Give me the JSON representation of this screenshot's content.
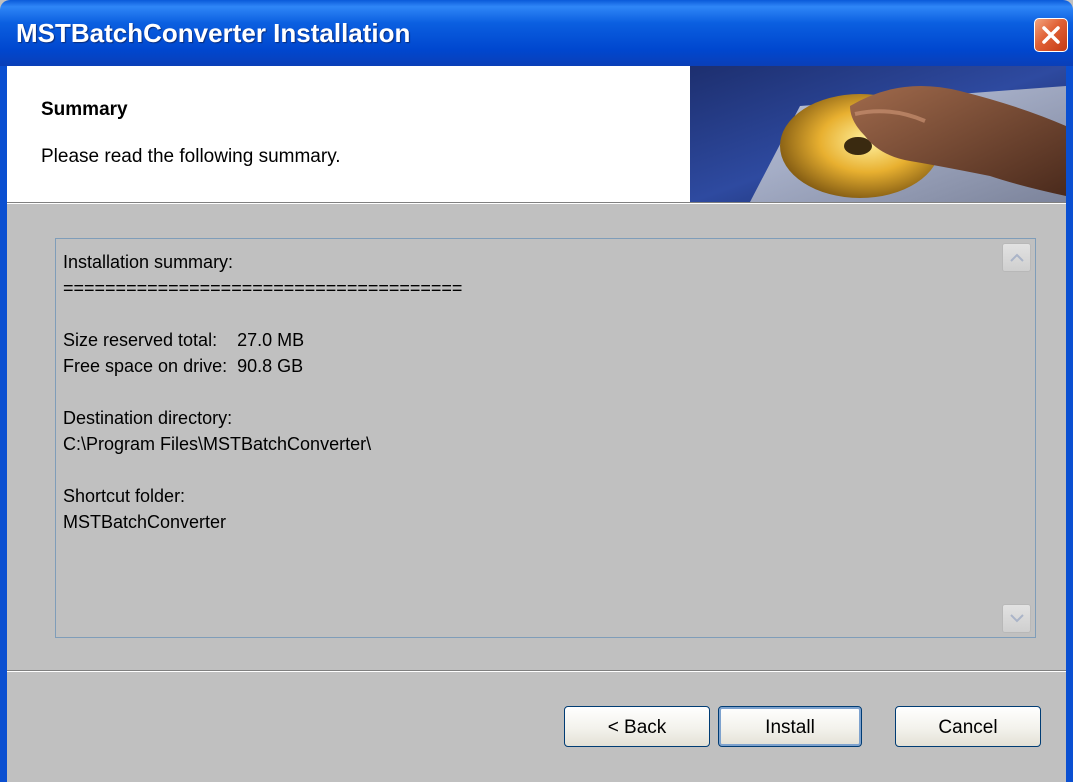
{
  "window": {
    "title": "MSTBatchConverter Installation"
  },
  "header": {
    "title": "Summary",
    "subtitle": "Please read the following summary."
  },
  "summary": {
    "text": "Installation summary:\n======================================\n\nSize reserved total:    27.0 MB\nFree space on drive:  90.8 GB\n\nDestination directory:\nC:\\Program Files\\MSTBatchConverter\\\n\nShortcut folder:\nMSTBatchConverter"
  },
  "buttons": {
    "back": "< Back",
    "install": "Install",
    "cancel": "Cancel"
  },
  "icons": {
    "close": "close-icon",
    "scroll_up": "arrow-up-icon",
    "scroll_down": "arrow-down-icon"
  },
  "colors": {
    "titlebar": "#0a5ad9",
    "close": "#e06035",
    "dialog_bg": "#c0c0c0"
  }
}
